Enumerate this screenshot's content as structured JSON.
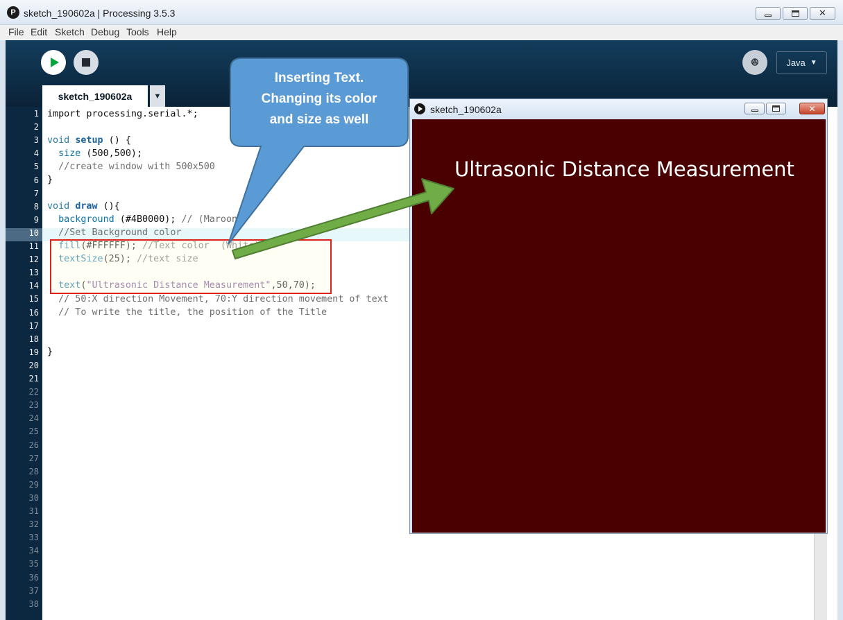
{
  "window": {
    "title": "sketch_190602a | Processing 3.5.3",
    "app_icon_glyph": "P",
    "controls": {
      "minimize": "minimize-icon",
      "maximize": "maximize-icon",
      "close": "close-icon",
      "close_glyph": "✕"
    }
  },
  "menu": [
    "File",
    "Edit",
    "Sketch",
    "Debug",
    "Tools",
    "Help"
  ],
  "toolbar": {
    "run": "play-icon",
    "stop": "stop-icon",
    "debug": "debugger-icon",
    "debug_glyph": "ꔮ",
    "mode_label": "Java",
    "mode_caret": "▼"
  },
  "tab": {
    "label": "sketch_190602a",
    "menu_glyph": "▼"
  },
  "editor": {
    "line_numbers": [
      "1",
      "2",
      "3",
      "4",
      "5",
      "6",
      "7",
      "8",
      "9",
      "10",
      "11",
      "12",
      "13",
      "14",
      "15",
      "16",
      "17",
      "18",
      "19",
      "20",
      "21",
      "22",
      "23",
      "24",
      "25",
      "26",
      "27",
      "28",
      "29",
      "30",
      "31",
      "32",
      "33",
      "34",
      "35",
      "36",
      "37",
      "38"
    ],
    "current_line": "10",
    "code": {
      "l1": {
        "a": "import processing.serial.*;"
      },
      "l3": {
        "a": "void",
        "b": "setup",
        "c": " () {"
      },
      "l4": {
        "a": "size",
        "b": " (500,500);"
      },
      "l5": {
        "a": "//create window with 500x500"
      },
      "l6": {
        "a": "}"
      },
      "l8": {
        "a": "void",
        "b": "draw",
        "c": " (){"
      },
      "l9": {
        "a": "background",
        "b": " (#4B0000); ",
        "c": "// (Maroon)"
      },
      "l10": {
        "a": "//Set Background color"
      },
      "l11": {
        "a": "fill",
        "b": "(#FFFFFF); ",
        "c": "//Text color  (White)"
      },
      "l12": {
        "a": "textSize",
        "b": "(25); ",
        "c": "//text size"
      },
      "l14": {
        "a": "text",
        "b": "(",
        "c": "\"Ultrasonic Distance Measurement\"",
        "d": ",50,70);"
      },
      "l15": {
        "a": "// 50:X direction Movement, 70:Y direction movement of text"
      },
      "l16": {
        "a": "// To write the title, the position of the Title"
      },
      "l19": {
        "a": "}"
      }
    }
  },
  "sketch_window": {
    "title": "sketch_190602a",
    "canvas_text": "Ultrasonic Distance Measurement",
    "close_glyph": "✕"
  },
  "callout": {
    "line1": "Inserting Text.",
    "line2": "Changing its color",
    "line3": "and size as well"
  },
  "colors": {
    "ide_header": "#0b2237",
    "gutter": "#0c2740",
    "canvas_background": "#4B0000",
    "canvas_text": "#FFFFFF",
    "callout_fill": "#5b9bd5",
    "arrow_fill": "#70ad47",
    "highlight_box": "#e0211b"
  }
}
